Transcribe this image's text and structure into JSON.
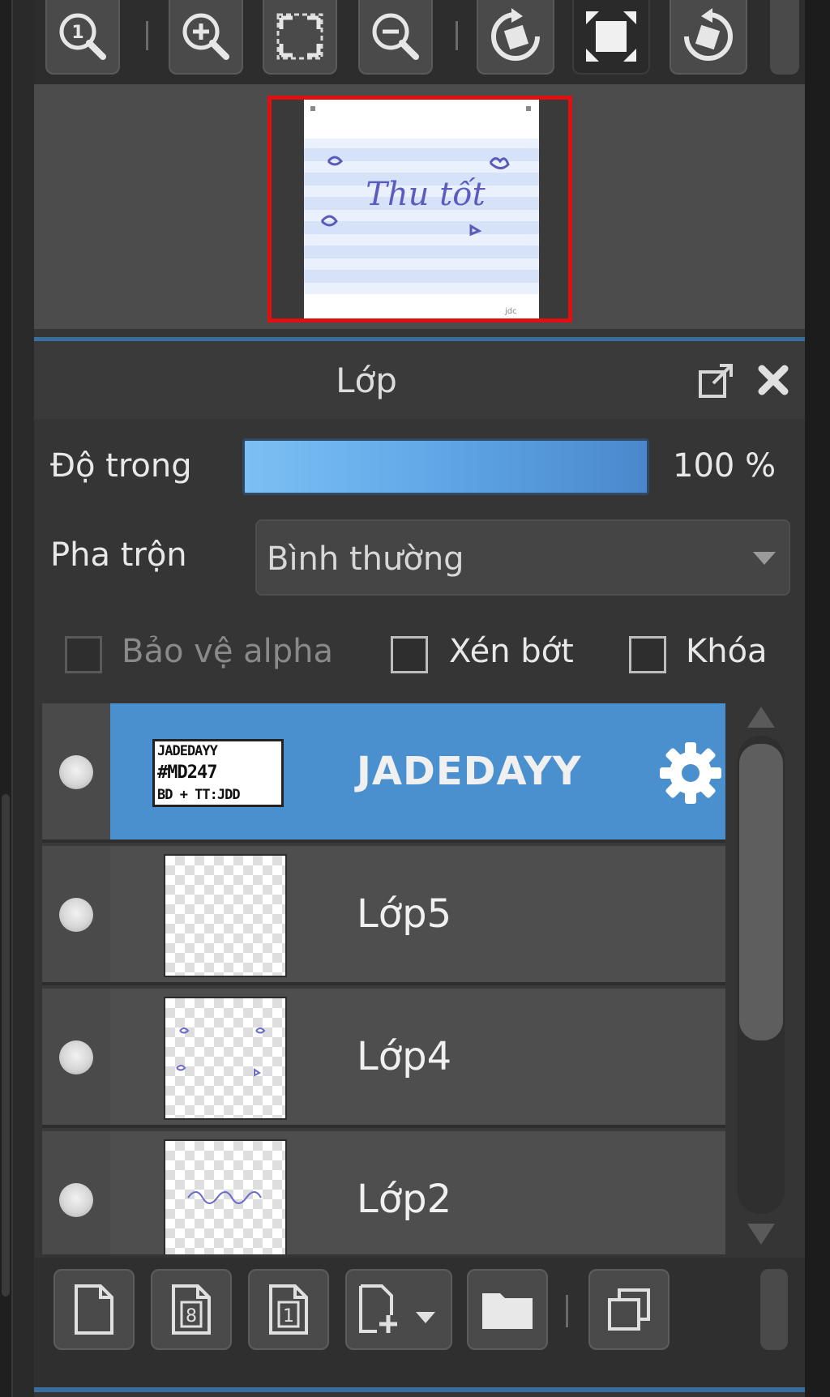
{
  "layers_panel": {
    "title": "Lớp",
    "opacity": {
      "label": "Độ trong",
      "value_text": "100 %",
      "value": 1.0
    },
    "blend": {
      "label": "Pha trộn",
      "selected": "Bình thường"
    },
    "checkboxes": [
      {
        "label": "Bảo vệ alpha",
        "checked": false,
        "enabled": false
      },
      {
        "label": "Xén bớt",
        "checked": false,
        "enabled": true
      },
      {
        "label": "Khóa",
        "checked": false,
        "enabled": true
      }
    ],
    "layers": [
      {
        "name": "JADEDAYY",
        "selected": true,
        "thumb_lines": [
          "JADEDAYY",
          "#MD247",
          "BD + TT:JDD"
        ]
      },
      {
        "name": "Lớp5",
        "selected": false
      },
      {
        "name": "Lớp4",
        "selected": false
      },
      {
        "name": "Lớp2",
        "selected": false
      }
    ]
  },
  "navigator": {
    "preview_text": "Thu tốt"
  },
  "icons": {
    "toolbar": [
      "zoom-actual-icon",
      "zoom-in-icon",
      "fit-screen-icon",
      "zoom-out-icon",
      "rotate-left-icon",
      "fullscreen-icon",
      "rotate-right-icon"
    ],
    "bottom": [
      "new-layer-icon",
      "new-8bit-layer-icon",
      "new-1bit-layer-icon",
      "add-layer-menu-icon",
      "folder-icon",
      "duplicate-layer-icon"
    ]
  },
  "colors": {
    "accent": "#4a8fce",
    "frame": "#e01010",
    "opacity_bar": "#5ea6e6"
  }
}
